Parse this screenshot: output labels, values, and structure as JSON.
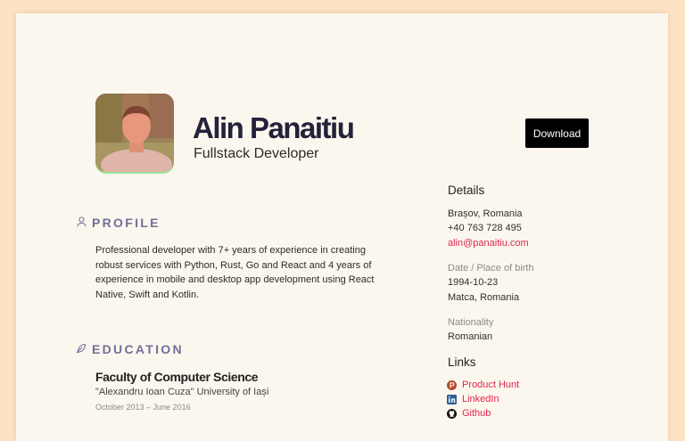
{
  "header": {
    "name": "Alin Panaitiu",
    "role": "Fullstack Developer",
    "download_label": "Download"
  },
  "profile": {
    "title": "PROFILE",
    "text": "Professional developer with 7+ years of experience in creating robust services with Python, Rust, Go and React and 4 years of experience in mobile and desktop app development using React Native, Swift and Kotlin."
  },
  "education": {
    "title": "EDUCATION",
    "school": "Faculty of Computer Science",
    "university": "\"Alexandru Ioan Cuza\" University of Iași",
    "dates": "October 2013  –  June 2016"
  },
  "details": {
    "title": "Details",
    "city": "Brașov, Romania",
    "phone": "+40 763 728 495",
    "email": "alin@panaitiu.com",
    "birth_label": "Date / Place of birth",
    "birth_date": "1994-10-23",
    "birth_place": "Matca, Romania",
    "nationality_label": "Nationality",
    "nationality": "Romanian"
  },
  "links": {
    "title": "Links",
    "items": [
      {
        "label": "Product Hunt",
        "icon": "product-hunt-icon",
        "color": "#da552f"
      },
      {
        "label": "LinkedIn",
        "icon": "linkedin-icon",
        "color": "#0a66c2"
      },
      {
        "label": "Github",
        "icon": "github-icon",
        "color": "#111111"
      }
    ]
  },
  "colors": {
    "background": "#fde3c4",
    "paper": "#fcf7ee",
    "accent": "#e0254d",
    "section_title": "#6f6f9a",
    "button": "#000000"
  }
}
